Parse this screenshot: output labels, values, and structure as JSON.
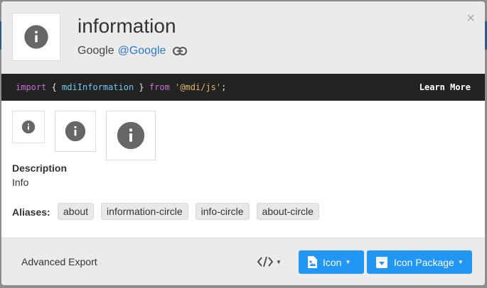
{
  "header": {
    "title": "information",
    "author_name": "Google",
    "author_handle": "@Google",
    "close_glyph": "×"
  },
  "code_bar": {
    "kw_import": "import",
    "brace_open": " { ",
    "identifier": "mdiInformation",
    "brace_close": " } ",
    "kw_from": "from",
    "space": " ",
    "module": "'@mdi/js'",
    "semicolon": ";",
    "learn_more": "Learn More"
  },
  "details": {
    "description_label": "Description",
    "description_value": "Info",
    "aliases_label": "Aliases:",
    "aliases": [
      "about",
      "information-circle",
      "info-circle",
      "about-circle"
    ]
  },
  "footer": {
    "advanced_export": "Advanced Export",
    "icon_button": "Icon",
    "icon_package_button": "Icon Package"
  },
  "icons": {
    "preview": "information-icon",
    "link": "link-icon",
    "code": "code-tags-icon",
    "image": "file-image-icon",
    "package": "package-down-icon"
  },
  "colors": {
    "accent": "#2196f3",
    "link": "#2a78c5",
    "code_bg": "#222222",
    "icon_fill": "#666666"
  }
}
